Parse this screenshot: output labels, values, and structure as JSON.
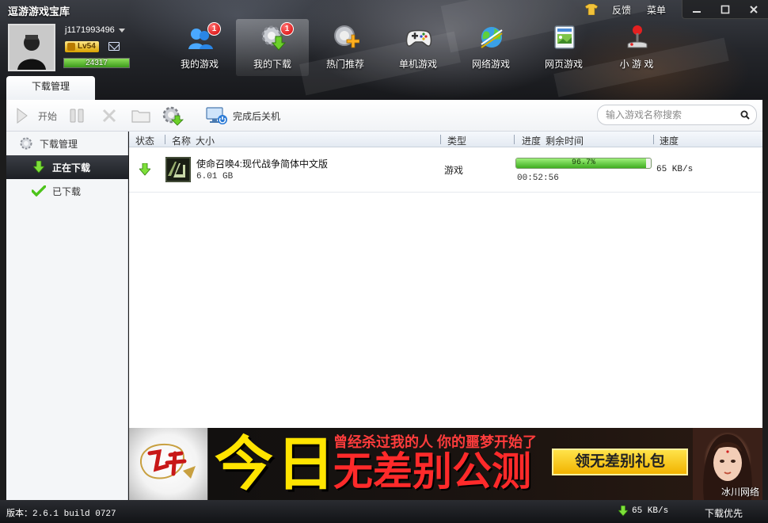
{
  "app": {
    "title": "逗游游戏宝库"
  },
  "top_actions": {
    "feedback": "反馈",
    "menu": "菜单"
  },
  "user": {
    "name": "j1171993496",
    "level": "Lv54",
    "exp": "24317",
    "exp_fraction": 1.0
  },
  "nav": [
    {
      "label": "我的游戏",
      "badge": "1",
      "icon": "my-games-icon"
    },
    {
      "label": "我的下载",
      "badge": "1",
      "icon": "download-gear-icon",
      "active": true
    },
    {
      "label": "热门推荐",
      "badge": "",
      "icon": "hot-recommend-icon"
    },
    {
      "label": "单机游戏",
      "badge": "",
      "icon": "gamepad-icon"
    },
    {
      "label": "网络游戏",
      "badge": "",
      "icon": "globe-icon"
    },
    {
      "label": "网页游戏",
      "badge": "",
      "icon": "webpage-icon"
    },
    {
      "label": "小 游 戏",
      "badge": "",
      "icon": "joystick-icon"
    }
  ],
  "main_tab": "下载管理",
  "toolbar": {
    "start": "开始",
    "shutdown_after": "完成后关机"
  },
  "search": {
    "placeholder": "输入游戏名称搜索",
    "value": ""
  },
  "sidebar": [
    {
      "label": "下载管理",
      "icon": "gear-icon"
    },
    {
      "label": "正在下载",
      "icon": "download-arrow-icon",
      "active": true
    },
    {
      "label": "已下载",
      "icon": "check-icon"
    }
  ],
  "columns": {
    "status": "状态",
    "name": "名称",
    "size": "大小",
    "type": "类型",
    "progress": "进度",
    "remaining": "剩余时间",
    "speed": "速度"
  },
  "downloads": [
    {
      "name": "使命召唤4:现代战争简体中文版",
      "size": "6.01 GB",
      "type": "游戏",
      "progress": "96.7%",
      "progress_value": 96.7,
      "remaining": "00:52:56",
      "speed": "65 KB/s"
    }
  ],
  "banner": {
    "big": "今日",
    "line1": "曾经杀过我的人 你的噩梦开始了",
    "line2": "无差别公测",
    "button": "领无差别礼包",
    "watermark": "冰川网络"
  },
  "status": {
    "version": "版本：2.6.1 build 0727",
    "speed": "65 KB/s",
    "priority": "下载优先"
  },
  "colors": {
    "accent_green": "#3fae20",
    "badge_red": "#d40000",
    "banner_yellow": "#ffe400",
    "banner_red": "#ff2a2a"
  }
}
